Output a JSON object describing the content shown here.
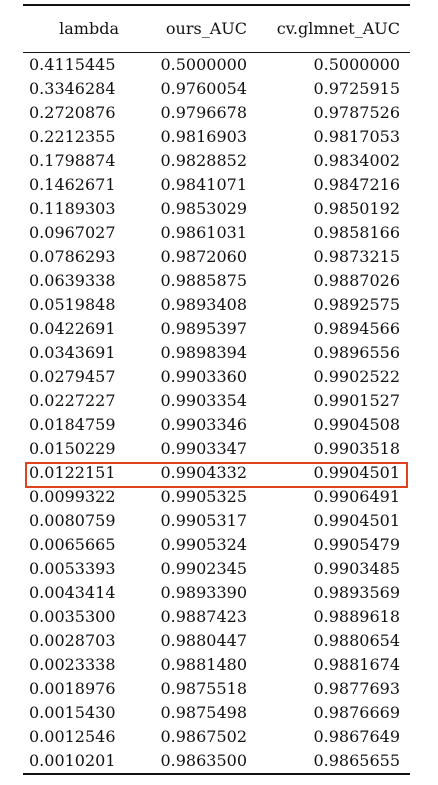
{
  "table": {
    "headers": [
      "lambda",
      "ours_AUC",
      "cv.glmnet_AUC"
    ],
    "highlight_row": 17,
    "highlight_color": "#e0411f",
    "rows": [
      [
        "0.4115445",
        "0.5000000",
        "0.5000000"
      ],
      [
        "0.3346284",
        "0.9760054",
        "0.9725915"
      ],
      [
        "0.2720876",
        "0.9796678",
        "0.9787526"
      ],
      [
        "0.2212355",
        "0.9816903",
        "0.9817053"
      ],
      [
        "0.1798874",
        "0.9828852",
        "0.9834002"
      ],
      [
        "0.1462671",
        "0.9841071",
        "0.9847216"
      ],
      [
        "0.1189303",
        "0.9853029",
        "0.9850192"
      ],
      [
        "0.0967027",
        "0.9861031",
        "0.9858166"
      ],
      [
        "0.0786293",
        "0.9872060",
        "0.9873215"
      ],
      [
        "0.0639338",
        "0.9885875",
        "0.9887026"
      ],
      [
        "0.0519848",
        "0.9893408",
        "0.9892575"
      ],
      [
        "0.0422691",
        "0.9895397",
        "0.9894566"
      ],
      [
        "0.0343691",
        "0.9898394",
        "0.9896556"
      ],
      [
        "0.0279457",
        "0.9903360",
        "0.9902522"
      ],
      [
        "0.0227227",
        "0.9903354",
        "0.9901527"
      ],
      [
        "0.0184759",
        "0.9903346",
        "0.9904508"
      ],
      [
        "0.0150229",
        "0.9903347",
        "0.9903518"
      ],
      [
        "0.0122151",
        "0.9904332",
        "0.9904501"
      ],
      [
        "0.0099322",
        "0.9905325",
        "0.9906491"
      ],
      [
        "0.0080759",
        "0.9905317",
        "0.9904501"
      ],
      [
        "0.0065665",
        "0.9905324",
        "0.9905479"
      ],
      [
        "0.0053393",
        "0.9902345",
        "0.9903485"
      ],
      [
        "0.0043414",
        "0.9893390",
        "0.9893569"
      ],
      [
        "0.0035300",
        "0.9887423",
        "0.9889618"
      ],
      [
        "0.0028703",
        "0.9880447",
        "0.9880654"
      ],
      [
        "0.0023338",
        "0.9881480",
        "0.9881674"
      ],
      [
        "0.0018976",
        "0.9875518",
        "0.9877693"
      ],
      [
        "0.0015430",
        "0.9875498",
        "0.9876669"
      ],
      [
        "0.0012546",
        "0.9867502",
        "0.9867649"
      ],
      [
        "0.0010201",
        "0.9863500",
        "0.9865655"
      ]
    ]
  }
}
